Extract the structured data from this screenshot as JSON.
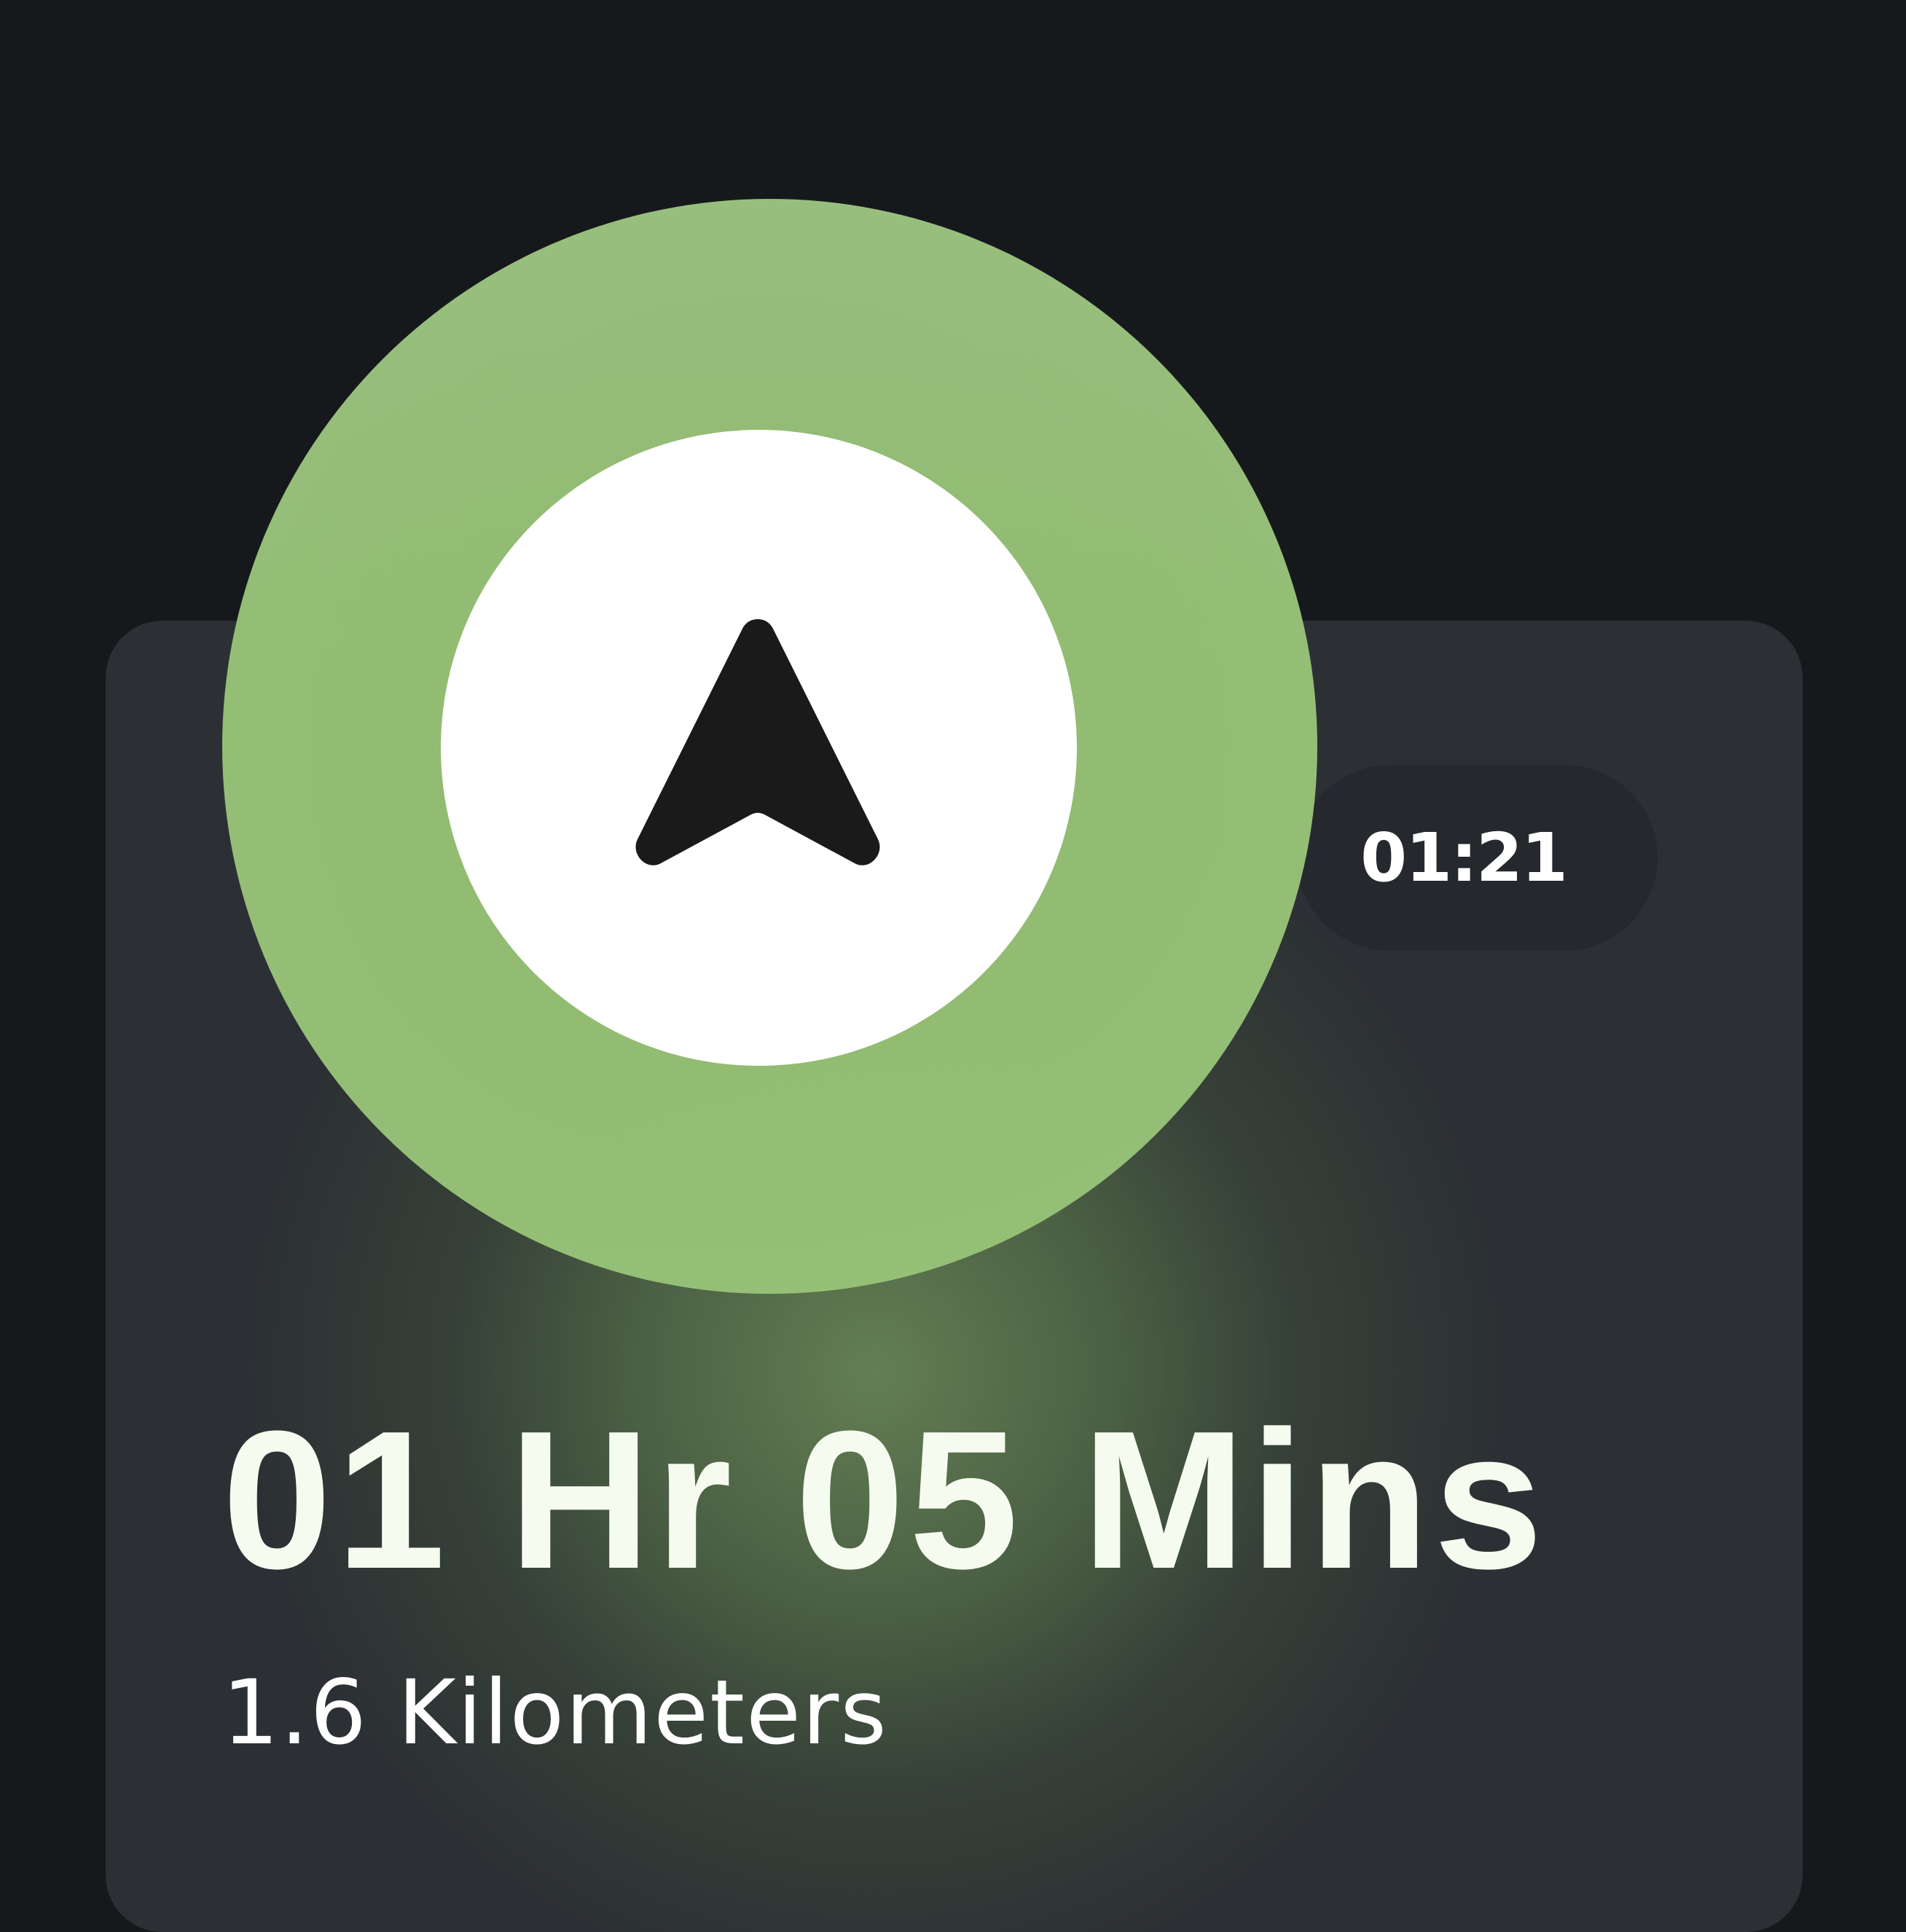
{
  "navigation": {
    "elapsed_time": "01:21",
    "duration": "01 Hr 05 Mins",
    "distance": "1.6 Kilometers",
    "direction_icon": "navigation-arrow-icon"
  },
  "colors": {
    "background": "#16191c",
    "card": "#2c3034",
    "ring_green": "#94bf74",
    "inner_circle": "#ffffff",
    "arrow": "#1a1a1a",
    "text_primary": "#ffffff"
  }
}
